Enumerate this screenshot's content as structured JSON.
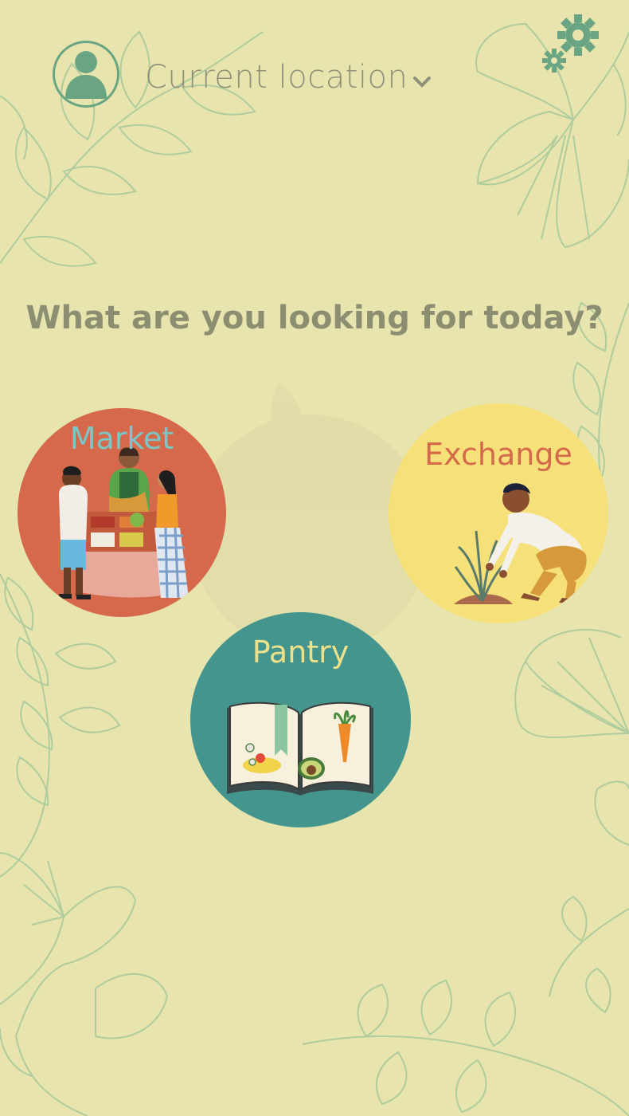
{
  "header": {
    "location_label": "Current location",
    "avatar_icon": "user-avatar-icon",
    "location_dropdown_icon": "chevron-down-icon",
    "settings_icon": "gear-icon"
  },
  "main": {
    "question": "What are you looking for today?",
    "options": [
      {
        "label": "Market",
        "color": "#d6694b",
        "icon": "market-stall-icon"
      },
      {
        "label": "Exchange",
        "color": "#f6e07a",
        "icon": "gardener-icon"
      },
      {
        "label": "Pantry",
        "color": "#44958d",
        "icon": "recipe-book-icon"
      }
    ]
  },
  "colors": {
    "background": "#e8e4ad",
    "accent_green": "#6aa583",
    "text_muted": "#8c8e72"
  }
}
